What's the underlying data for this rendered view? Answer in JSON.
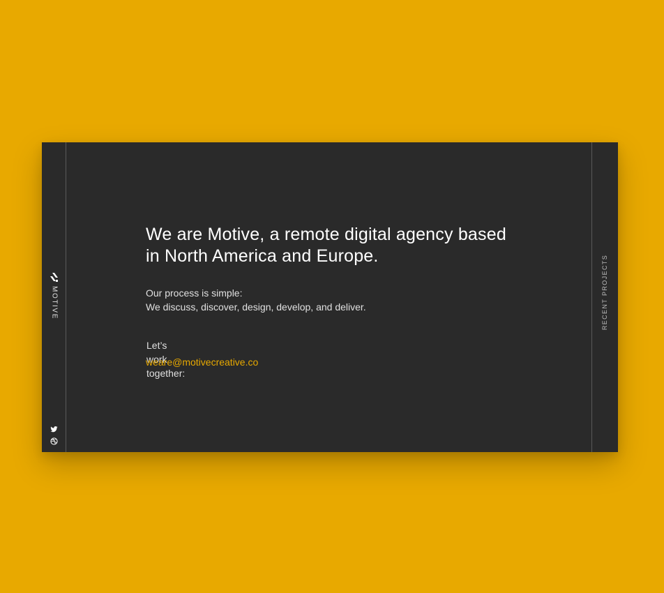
{
  "brand": {
    "name": "MOTIVE",
    "logo_icon": "motive-logo-icon"
  },
  "colors": {
    "page_background": "#E8A900",
    "card_background": "#2a2a2a",
    "accent": "#E8A900",
    "text": "#ffffff"
  },
  "sidebar_right": {
    "label": "RECENT PROJECTS"
  },
  "social": {
    "items": [
      {
        "name": "twitter",
        "icon": "twitter-icon"
      },
      {
        "name": "dribbble",
        "icon": "dribbble-icon"
      }
    ]
  },
  "main": {
    "headline": "We are Motive, a remote digital agency based in North America and Europe.",
    "process_intro": "Our process is simple:",
    "process_steps": "We discuss, discover, design, develop, and deliver.",
    "cta": "Let’s work together:",
    "email": "weare@motivecreative.co"
  }
}
